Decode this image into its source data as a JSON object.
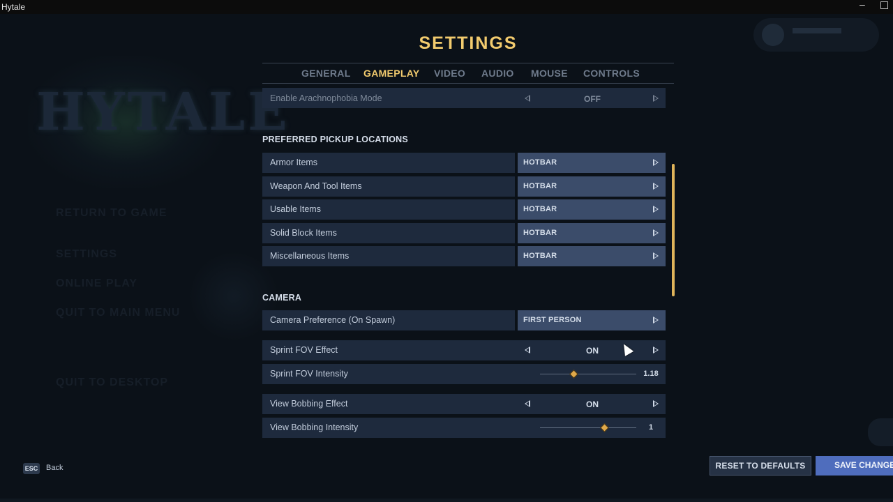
{
  "window": {
    "title": "Hytale"
  },
  "background": {
    "logo_text": "HYTALE",
    "menu": [
      "RETURN TO GAME",
      "SETTINGS",
      "ONLINE PLAY",
      "QUIT TO MAIN MENU",
      "QUIT TO DESKTOP"
    ]
  },
  "settings": {
    "title": "SETTINGS",
    "tabs": [
      "GENERAL",
      "GAMEPLAY",
      "VIDEO",
      "AUDIO",
      "MOUSE",
      "CONTROLS"
    ],
    "active_tab": "GAMEPLAY"
  },
  "rows": {
    "arachnophobia": {
      "label": "Enable Arachnophobia Mode",
      "value": "OFF"
    },
    "pickup_heading": "PREFERRED PICKUP LOCATIONS",
    "pickup": [
      {
        "label": "Armor Items",
        "value": "HOTBAR"
      },
      {
        "label": "Weapon And Tool Items",
        "value": "HOTBAR"
      },
      {
        "label": "Usable Items",
        "value": "HOTBAR"
      },
      {
        "label": "Solid Block Items",
        "value": "HOTBAR"
      },
      {
        "label": "Miscellaneous Items",
        "value": "HOTBAR"
      }
    ],
    "camera_heading": "CAMERA",
    "camera_pref": {
      "label": "Camera Preference (On Spawn)",
      "value": "FIRST PERSON"
    },
    "sprint_fov": {
      "label": "Sprint FOV Effect",
      "value": "ON"
    },
    "sprint_fov_intensity": {
      "label": "Sprint FOV Intensity",
      "value": "1.18",
      "level": 0.35
    },
    "view_bobbing": {
      "label": "View Bobbing Effect",
      "value": "ON"
    },
    "view_bobbing_intensity": {
      "label": "View Bobbing Intensity",
      "value": "1",
      "level": 0.67
    }
  },
  "footer": {
    "esc_key": "ESC",
    "back_label": "Back",
    "reset_label": "RESET TO DEFAULTS",
    "save_label": "SAVE CHANGES"
  },
  "colors": {
    "accent_gold": "#f2cb6e",
    "row_bg": "#1e2a3d",
    "value_bg": "#3b4c6a",
    "save_button": "#4f6dbd"
  }
}
